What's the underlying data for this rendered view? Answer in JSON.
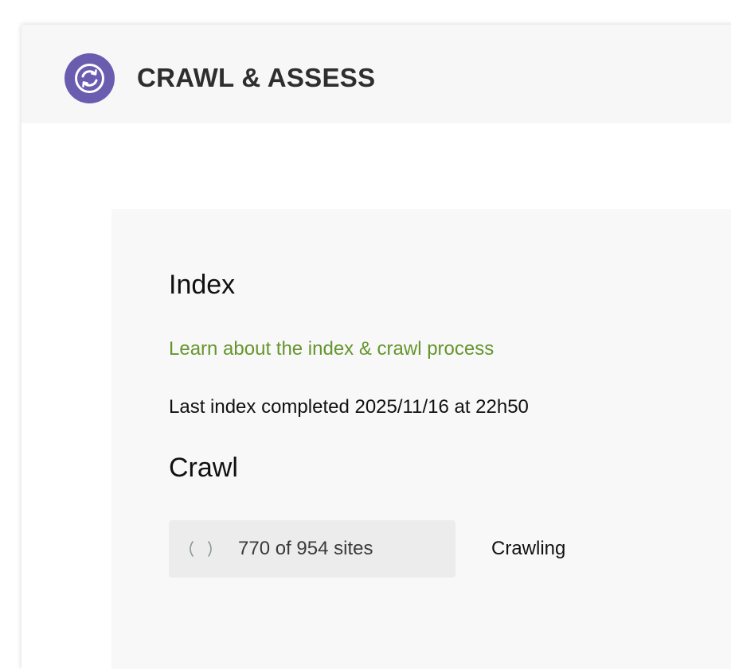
{
  "app": {
    "title": "CRAWL & ASSESS",
    "logo_icon": "sync-icon",
    "brand_color": "#6a5db0"
  },
  "index_section": {
    "title": "Index",
    "learn_link": "Learn about the index & crawl process",
    "link_color": "#66952e",
    "last_index_text": "Last index completed 2025/11/16 at 22h50"
  },
  "crawl_section": {
    "title": "Crawl",
    "spinner_icon": "loading-spinner-icon",
    "progress_text": "770 of 954 sites",
    "sites_crawled": 770,
    "sites_total": 954,
    "status": "Crawling"
  }
}
